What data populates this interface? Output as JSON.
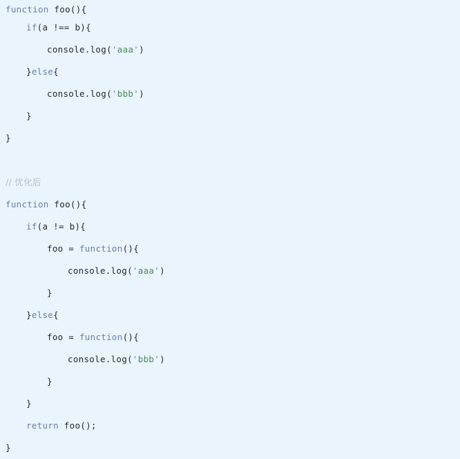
{
  "editor": {
    "background_color": "#eaf4fc",
    "keyword_color": "#6a7fa8",
    "identifier_color": "#24292e",
    "string_color": "#4a8a5c",
    "comment_color": "#b5bfc9",
    "language": "javascript"
  },
  "code": {
    "lines": [
      {
        "id": "l1",
        "indent": 0,
        "tokens": [
          {
            "t": "kw",
            "v": "function"
          },
          {
            "t": "def",
            "v": " foo(){"
          }
        ]
      },
      {
        "id": "l2",
        "indent": 1,
        "tokens": [
          {
            "t": "kw",
            "v": "if"
          },
          {
            "t": "punc",
            "v": "(a "
          },
          {
            "t": "op",
            "v": "!=="
          },
          {
            "t": "punc",
            "v": " b){"
          }
        ]
      },
      {
        "id": "l3",
        "indent": 2,
        "tokens": [
          {
            "t": "def",
            "v": "console.log("
          },
          {
            "t": "q",
            "v": "'"
          },
          {
            "t": "str",
            "v": "aaa"
          },
          {
            "t": "q",
            "v": "'"
          },
          {
            "t": "def",
            "v": ")"
          }
        ]
      },
      {
        "id": "l4",
        "indent": 1,
        "tokens": [
          {
            "t": "punc",
            "v": "}"
          },
          {
            "t": "kw",
            "v": "else"
          },
          {
            "t": "punc",
            "v": "{"
          }
        ]
      },
      {
        "id": "l5",
        "indent": 2,
        "tokens": [
          {
            "t": "def",
            "v": "console.log("
          },
          {
            "t": "q",
            "v": "'"
          },
          {
            "t": "str",
            "v": "bbb"
          },
          {
            "t": "q",
            "v": "'"
          },
          {
            "t": "def",
            "v": ")"
          }
        ]
      },
      {
        "id": "l6",
        "indent": 1,
        "tokens": [
          {
            "t": "punc",
            "v": "}"
          }
        ]
      },
      {
        "id": "l7",
        "indent": 0,
        "tokens": [
          {
            "t": "punc",
            "v": "}"
          }
        ]
      },
      {
        "id": "l8",
        "indent": 0,
        "blank": true,
        "tokens": []
      },
      {
        "id": "l9",
        "indent": 0,
        "tokens": [
          {
            "t": "cmt",
            "v": "// 优化后"
          }
        ]
      },
      {
        "id": "l10",
        "indent": 0,
        "tokens": [
          {
            "t": "kw",
            "v": "function"
          },
          {
            "t": "def",
            "v": " foo(){"
          }
        ]
      },
      {
        "id": "l11",
        "indent": 1,
        "tokens": [
          {
            "t": "kw",
            "v": "if"
          },
          {
            "t": "punc",
            "v": "(a "
          },
          {
            "t": "op",
            "v": "!="
          },
          {
            "t": "punc",
            "v": " b){"
          }
        ]
      },
      {
        "id": "l12",
        "indent": 2,
        "tokens": [
          {
            "t": "def",
            "v": "foo = "
          },
          {
            "t": "kw",
            "v": "function"
          },
          {
            "t": "punc",
            "v": "(){"
          }
        ]
      },
      {
        "id": "l13",
        "indent": 3,
        "tokens": [
          {
            "t": "def",
            "v": "console.log("
          },
          {
            "t": "q",
            "v": "'"
          },
          {
            "t": "str",
            "v": "aaa"
          },
          {
            "t": "q",
            "v": "'"
          },
          {
            "t": "def",
            "v": ")"
          }
        ]
      },
      {
        "id": "l14",
        "indent": 2,
        "tokens": [
          {
            "t": "punc",
            "v": "}"
          }
        ]
      },
      {
        "id": "l15",
        "indent": 1,
        "tokens": [
          {
            "t": "punc",
            "v": "}"
          },
          {
            "t": "kw",
            "v": "else"
          },
          {
            "t": "punc",
            "v": "{"
          }
        ]
      },
      {
        "id": "l16",
        "indent": 2,
        "tokens": [
          {
            "t": "def",
            "v": "foo = "
          },
          {
            "t": "kw",
            "v": "function"
          },
          {
            "t": "punc",
            "v": "(){"
          }
        ]
      },
      {
        "id": "l17",
        "indent": 3,
        "tokens": [
          {
            "t": "def",
            "v": "console.log("
          },
          {
            "t": "q",
            "v": "'"
          },
          {
            "t": "str",
            "v": "bbb"
          },
          {
            "t": "q",
            "v": "'"
          },
          {
            "t": "def",
            "v": ")"
          }
        ]
      },
      {
        "id": "l18",
        "indent": 2,
        "tokens": [
          {
            "t": "punc",
            "v": "}"
          }
        ]
      },
      {
        "id": "l19",
        "indent": 1,
        "tokens": [
          {
            "t": "punc",
            "v": "}"
          }
        ]
      },
      {
        "id": "l20",
        "indent": 1,
        "tokens": [
          {
            "t": "kw",
            "v": "return"
          },
          {
            "t": "def",
            "v": " foo();"
          }
        ]
      },
      {
        "id": "l21",
        "indent": 0,
        "tokens": [
          {
            "t": "punc",
            "v": "}"
          }
        ]
      }
    ]
  }
}
